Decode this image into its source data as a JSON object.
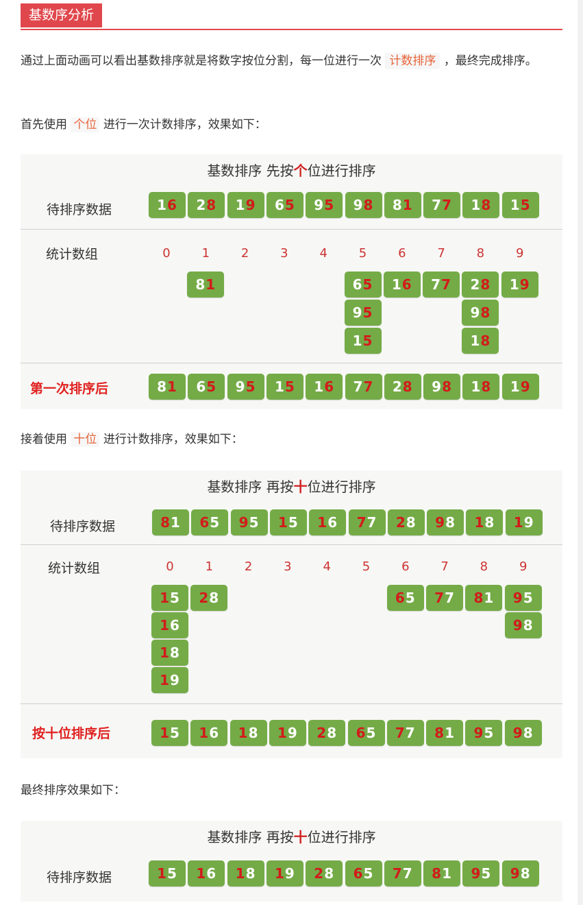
{
  "heading": "基数序分析",
  "para1": {
    "before": "通过上面动画可以看出基数排序就是将数字按位分割，每一位进行一次",
    "code": "计数排序",
    "after": "，最终完成排序。"
  },
  "para2": {
    "before": "首先使用",
    "hl": "个位",
    "after": "进行一次计数排序，效果如下："
  },
  "para3": {
    "before": "接着使用",
    "hl": "十位",
    "after": "进行计数排序，效果如下："
  },
  "para4": "最终排序效果如下：",
  "panel1": {
    "title_before": "基数排序  先按",
    "title_red": "个",
    "title_after": "位进行排序",
    "input_label": "待排序数据",
    "input": [
      "16",
      "28",
      "19",
      "65",
      "95",
      "98",
      "81",
      "77",
      "18",
      "15"
    ],
    "bucket_label": "统计数组",
    "bucket_indices": [
      "0",
      "1",
      "2",
      "3",
      "4",
      "5",
      "6",
      "7",
      "8",
      "9"
    ],
    "buckets": [
      [],
      [
        "81"
      ],
      [],
      [],
      [],
      [
        "65",
        "95",
        "15"
      ],
      [
        "16"
      ],
      [
        "77"
      ],
      [
        "28",
        "98",
        "18"
      ],
      [
        "19"
      ]
    ],
    "result_label": "第一次排序后",
    "result": [
      "81",
      "65",
      "95",
      "15",
      "16",
      "77",
      "28",
      "98",
      "18",
      "19"
    ]
  },
  "panel2": {
    "title_before": "基数排序  再按",
    "title_red": "十",
    "title_after": "位进行排序",
    "input_label": "待排序数据",
    "input": [
      "81",
      "65",
      "95",
      "15",
      "16",
      "77",
      "28",
      "98",
      "18",
      "19"
    ],
    "bucket_label": "统计数组",
    "bucket_indices": [
      "0",
      "1",
      "2",
      "3",
      "4",
      "5",
      "6",
      "7",
      "8",
      "9"
    ],
    "buckets": [
      [
        "15",
        "16",
        "18",
        "19"
      ],
      [
        "28"
      ],
      [],
      [],
      [],
      [],
      [
        "65"
      ],
      [
        "77"
      ],
      [
        "81"
      ],
      [
        "95",
        "98"
      ]
    ],
    "result_label": "按十位排序后",
    "result": [
      "15",
      "16",
      "18",
      "19",
      "28",
      "65",
      "77",
      "81",
      "95",
      "98"
    ]
  },
  "panel3": {
    "title_before": "基数排序  再按",
    "title_red": "十",
    "title_after": "位进行排序",
    "input_label": "待排序数据",
    "input": [
      "15",
      "16",
      "18",
      "19",
      "28",
      "65",
      "77",
      "81",
      "95",
      "98"
    ]
  }
}
